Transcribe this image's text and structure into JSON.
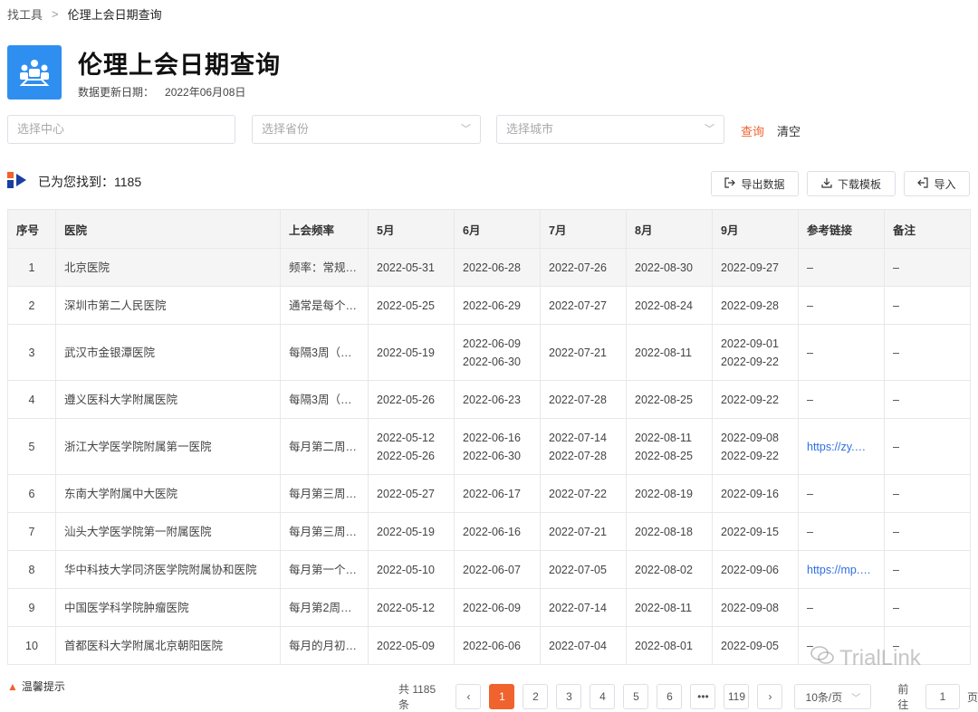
{
  "breadcrumb": {
    "parent": "找工具",
    "sep": ">",
    "current": "伦理上会日期查询"
  },
  "header": {
    "title": "伦理上会日期查询",
    "update_label": "数据更新日期：",
    "update_date": "2022年06月08日"
  },
  "filters": {
    "center_placeholder": "选择中心",
    "province_placeholder": "选择省份",
    "city_placeholder": "选择城市",
    "query_label": "查询",
    "clear_label": "清空"
  },
  "results": {
    "found_label": "已为您找到：",
    "count": "1185"
  },
  "toolbar": {
    "export_label": "导出数据",
    "download_label": "下载模板",
    "import_label": "导入"
  },
  "table": {
    "columns": [
      "序号",
      "医院",
      "上会频率",
      "5月",
      "6月",
      "7月",
      "8月",
      "9月",
      "参考链接",
      "备注"
    ],
    "rows": [
      {
        "no": "1",
        "hospital": "北京医院",
        "freq": "频率：常规…",
        "m5": [
          "2022-05-31"
        ],
        "m6": [
          "2022-06-28"
        ],
        "m7": [
          "2022-07-26"
        ],
        "m8": [
          "2022-08-30"
        ],
        "m9": [
          "2022-09-27"
        ],
        "link": "–",
        "note": "–"
      },
      {
        "no": "2",
        "hospital": "深圳市第二人民医院",
        "freq": "通常是每个…",
        "m5": [
          "2022-05-25"
        ],
        "m6": [
          "2022-06-29"
        ],
        "m7": [
          "2022-07-27"
        ],
        "m8": [
          "2022-08-24"
        ],
        "m9": [
          "2022-09-28"
        ],
        "link": "–",
        "note": "–"
      },
      {
        "no": "3",
        "hospital": "武汉市金银潭医院",
        "freq": "每隔3周（…",
        "m5": [
          "2022-05-19"
        ],
        "m6": [
          "2022-06-09",
          "2022-06-30"
        ],
        "m7": [
          "2022-07-21"
        ],
        "m8": [
          "2022-08-11"
        ],
        "m9": [
          "2022-09-01",
          "2022-09-22"
        ],
        "link": "–",
        "note": "–"
      },
      {
        "no": "4",
        "hospital": "遵义医科大学附属医院",
        "freq": "每隔3周（…",
        "m5": [
          "2022-05-26"
        ],
        "m6": [
          "2022-06-23"
        ],
        "m7": [
          "2022-07-28"
        ],
        "m8": [
          "2022-08-25"
        ],
        "m9": [
          "2022-09-22"
        ],
        "link": "–",
        "note": "–"
      },
      {
        "no": "5",
        "hospital": "浙江大学医学院附属第一医院",
        "freq": "每月第二周…",
        "m5": [
          "2022-05-12",
          "2022-05-26"
        ],
        "m6": [
          "2022-06-16",
          "2022-06-30"
        ],
        "m7": [
          "2022-07-14",
          "2022-07-28"
        ],
        "m8": [
          "2022-08-11",
          "2022-08-25"
        ],
        "m9": [
          "2022-09-08",
          "2022-09-22"
        ],
        "link": "https://zy.…",
        "note": "–"
      },
      {
        "no": "6",
        "hospital": "东南大学附属中大医院",
        "freq": "每月第三周…",
        "m5": [
          "2022-05-27"
        ],
        "m6": [
          "2022-06-17"
        ],
        "m7": [
          "2022-07-22"
        ],
        "m8": [
          "2022-08-19"
        ],
        "m9": [
          "2022-09-16"
        ],
        "link": "–",
        "note": "–"
      },
      {
        "no": "7",
        "hospital": "汕头大学医学院第一附属医院",
        "freq": "每月第三周…",
        "m5": [
          "2022-05-19"
        ],
        "m6": [
          "2022-06-16"
        ],
        "m7": [
          "2022-07-21"
        ],
        "m8": [
          "2022-08-18"
        ],
        "m9": [
          "2022-09-15"
        ],
        "link": "–",
        "note": "–"
      },
      {
        "no": "8",
        "hospital": "华中科技大学同济医学院附属协和医院",
        "freq": "每月第一个…",
        "m5": [
          "2022-05-10"
        ],
        "m6": [
          "2022-06-07"
        ],
        "m7": [
          "2022-07-05"
        ],
        "m8": [
          "2022-08-02"
        ],
        "m9": [
          "2022-09-06"
        ],
        "link": "https://mp.…",
        "note": "–"
      },
      {
        "no": "9",
        "hospital": "中国医学科学院肿瘤医院",
        "freq": "每月第2周…",
        "m5": [
          "2022-05-12"
        ],
        "m6": [
          "2022-06-09"
        ],
        "m7": [
          "2022-07-14"
        ],
        "m8": [
          "2022-08-11"
        ],
        "m9": [
          "2022-09-08"
        ],
        "link": "–",
        "note": "–"
      },
      {
        "no": "10",
        "hospital": "首都医科大学附属北京朝阳医院",
        "freq": "每月的月初…",
        "m5": [
          "2022-05-09"
        ],
        "m6": [
          "2022-06-06"
        ],
        "m7": [
          "2022-07-04"
        ],
        "m8": [
          "2022-08-01"
        ],
        "m9": [
          "2022-09-05"
        ],
        "link": "–",
        "note": "–"
      }
    ]
  },
  "footer": {
    "tip_label": "温馨提示",
    "total_label": "共 1185 条",
    "pages": [
      "1",
      "2",
      "3",
      "4",
      "5",
      "6",
      "•••",
      "119"
    ],
    "page_size": "10条/页",
    "goto_label": "前往",
    "goto_value": "1",
    "page_unit": "页",
    "watermark": "TrialLink"
  },
  "colors": {
    "accent": "#f0632e",
    "icon_bg": "#2f8ff0",
    "link": "#2f6fe4"
  }
}
